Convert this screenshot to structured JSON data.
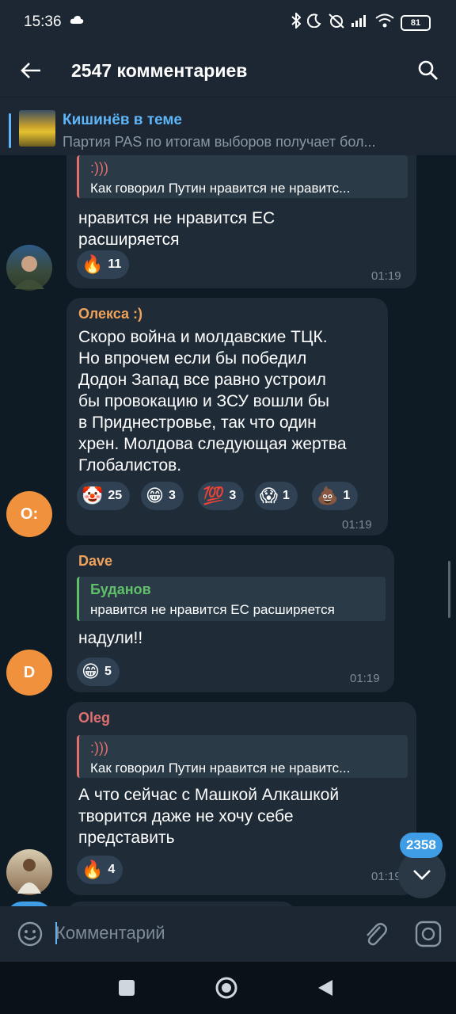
{
  "status_bar": {
    "time": "15:36",
    "battery": "81"
  },
  "header": {
    "title": "2547 комментариев"
  },
  "pinned": {
    "title": "Кишинёв в теме",
    "text": "Партия PAS по итогам выборов получает бол..."
  },
  "colors": {
    "accent": "#5eb5f7",
    "bubble": "#1f2c38",
    "background": "#0e1a24"
  },
  "messages": [
    {
      "reply_name": ":)))",
      "reply_text": "Как говорил Путин нравится не нравитс...",
      "text": "нравится не нравится ЕС\nрасширяется",
      "reactions": [
        {
          "emoji": "🔥",
          "count": "11"
        }
      ],
      "time": "01:19"
    },
    {
      "author": "Олекса :)",
      "text": "Скоро война и молдавские ТЦК.\nНо впрочем если бы победил\nДодон Запад все равно устроил\nбы провокацию и ЗСУ вошли бы\nв Приднестровье, так что один\nхрен. Молдова следующая жертва\nГлобалистов.",
      "reactions": [
        {
          "emoji": "🤡",
          "count": "25"
        },
        {
          "emoji": "😁",
          "count": "3"
        },
        {
          "emoji": "💯",
          "count": "3"
        },
        {
          "emoji": "😱",
          "count": "1"
        },
        {
          "emoji": "💩",
          "count": "1"
        }
      ],
      "time": "01:19",
      "avatar_initials": "О:"
    },
    {
      "author": "Dave",
      "reply_name": "Буданов",
      "reply_text": "нравится не нравится ЕС расширяется",
      "text": "надули!!",
      "reactions": [
        {
          "emoji": "😁",
          "count": "5"
        }
      ],
      "time": "01:19",
      "avatar_initials": "D"
    },
    {
      "author": "Oleg",
      "reply_name": ":)))",
      "reply_text": "Как говорил Путин нравится не нравитс...",
      "text": "А что сейчас с Машкой Алкашкой\nтворится даже не хочу себе\nпредставить",
      "reactions": [
        {
          "emoji": "🔥",
          "count": "4"
        }
      ],
      "time": "01:19"
    }
  ],
  "unread_badge": "2358",
  "input": {
    "placeholder": "Комментарий"
  }
}
